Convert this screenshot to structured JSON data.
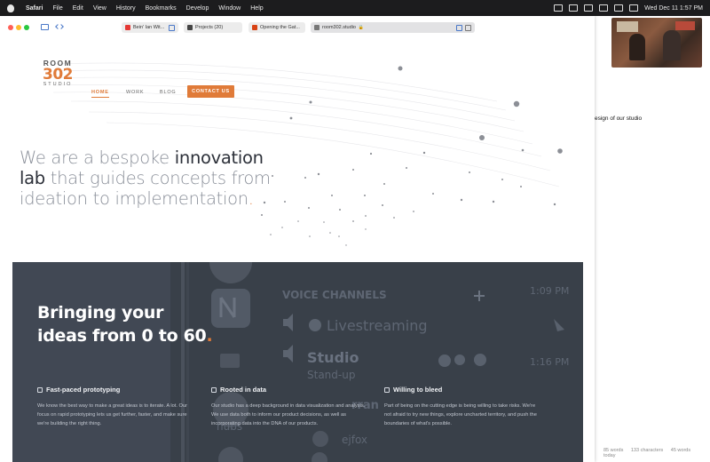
{
  "menubar": {
    "app": "Safari",
    "items": [
      "File",
      "Edit",
      "View",
      "History",
      "Bookmarks",
      "Develop",
      "Window",
      "Help"
    ],
    "clock": "Wed Dec 11  1:57 PM"
  },
  "browser": {
    "tabs": [
      {
        "label": "Bein' Ian Wit...",
        "favicon_color": "#e53935"
      },
      {
        "label": "Projects (20)",
        "favicon_color": "#444444"
      },
      {
        "label": "Opening the Gat...",
        "favicon_color": "#d84315"
      },
      {
        "label": "room302.studio",
        "favicon_color": "#777777",
        "active": true
      }
    ]
  },
  "site": {
    "logo": {
      "line1": "ROOM",
      "line2": "302",
      "line3": "STUDIO"
    },
    "nav": {
      "home": "HOME",
      "work": "WORK",
      "blog": "BLOG",
      "contact": "CONTACT US"
    },
    "hero": {
      "part1": "We are a bespoke ",
      "strong1": "innovation",
      "strong2": "lab",
      "part2": " that guides concepts from ideation to implementation",
      "dot": "."
    },
    "banner": {
      "title_line1": "Bringing your",
      "title_line2": "ideas from 0 to 60",
      "title_dot": ".",
      "features": [
        {
          "icon": "rocket-icon",
          "title": "Fast-paced prototyping",
          "body": "We know the best way to make a great ideas is to iterate. A lot. Our focus on rapid prototyping lets us get further, faster, and make sure we're building the right thing."
        },
        {
          "icon": "chart-icon",
          "title": "Rooted in data",
          "body": "Our studio has a deep background in data visualization and analysis. We use data both to inform our product decisions, as well as incorporating data into the DNA of our products."
        },
        {
          "icon": "hammer-icon",
          "title": "Willing to bleed",
          "body": "Part of being on the cutting edge is being willing to take risks. We're not afraid to try new things, explore uncharted territory, and push the boundaries of what's possible."
        }
      ],
      "background_text": {
        "voice_channels": "VOICE CHANNELS",
        "livestreaming": "Livestreaming",
        "studio": "Studio",
        "standup": "Stand-up",
        "time1": "1:09 PM",
        "time2": "1:16 PM",
        "hubs": "hubs",
        "ejfox": "ejfox",
        "fragment": "rran"
      }
    }
  },
  "desktop": {
    "doc_snippet": "esign of our studio",
    "status": [
      "85 words",
      "133 characters",
      "45 words today"
    ]
  },
  "colors": {
    "accent": "#e07b39",
    "banner_bg": "#414854",
    "menubar_bg": "#1c1c1e"
  }
}
